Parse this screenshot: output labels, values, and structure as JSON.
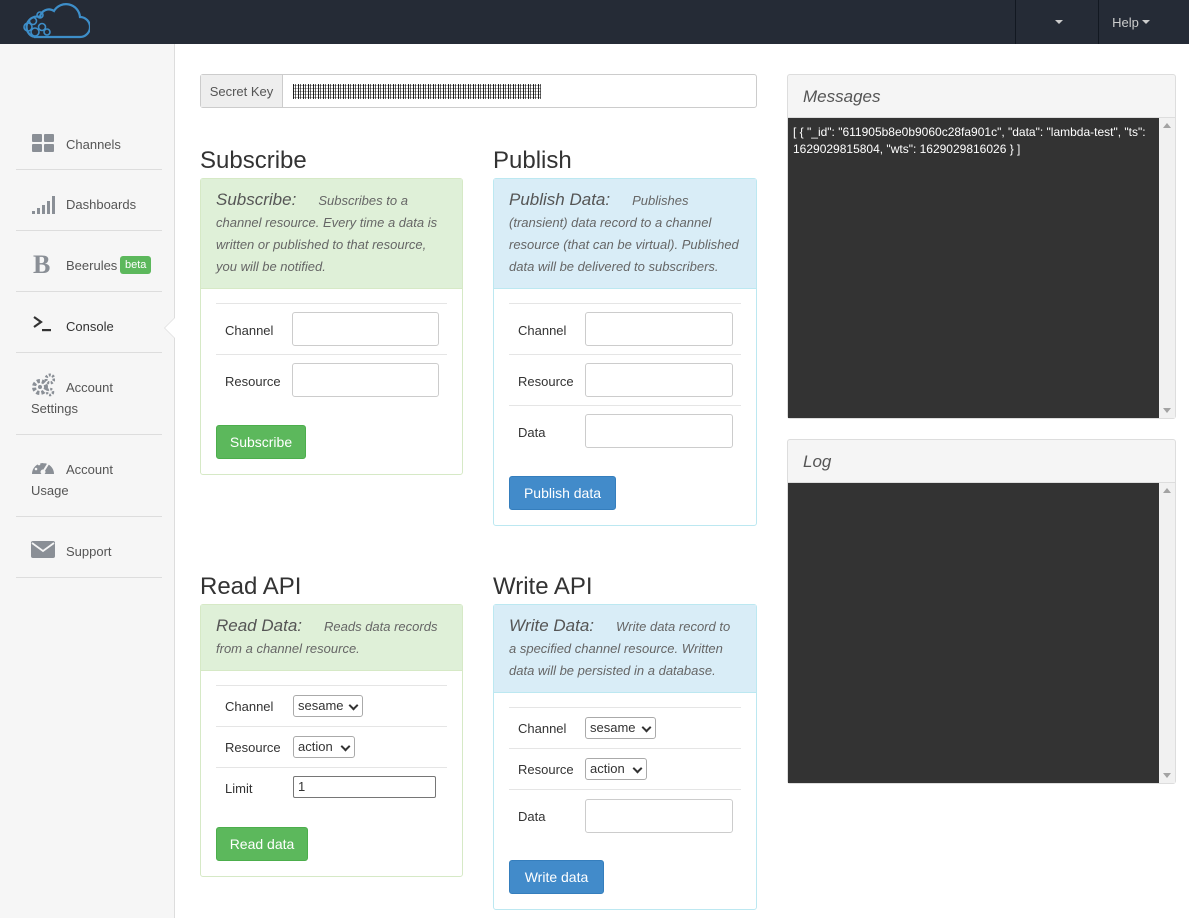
{
  "navbar": {
    "logo_icon": "cloud-logo-icon",
    "menu_dropdown_icon": "caret-down-icon",
    "help_label": "Help"
  },
  "sidebar": {
    "items": [
      {
        "label": "Channels",
        "icon": "grid-icon"
      },
      {
        "label": "Dashboards",
        "icon": "signal-bars-icon"
      },
      {
        "label": "Beerules",
        "icon": "bold-b-icon",
        "badge": "beta"
      },
      {
        "label": "Console",
        "icon": "terminal-icon",
        "active": true
      },
      {
        "label": "Account",
        "label2": "Settings",
        "icon": "gears-icon"
      },
      {
        "label": "Account",
        "label2": "Usage",
        "icon": "dashboard-gauge-icon"
      },
      {
        "label": "Support",
        "icon": "envelope-icon"
      }
    ]
  },
  "secret_key": {
    "label": "Secret Key"
  },
  "subscribe": {
    "section_title": "Subscribe",
    "head_title": "Subscribe:",
    "description": "Subscribes to a channel resource. Every time a data is written or published to that resource, you will be notified.",
    "channel_label": "Channel",
    "resource_label": "Resource",
    "button": "Subscribe"
  },
  "publish": {
    "section_title": "Publish",
    "head_title": "Publish Data:",
    "description": "Publishes (transient) data record to a channel resource (that can be virtual). Published data will be delivered to subscribers.",
    "channel_label": "Channel",
    "resource_label": "Resource",
    "data_label": "Data",
    "button": "Publish data"
  },
  "read_api": {
    "section_title": "Read API",
    "head_title": "Read Data:",
    "description": "Reads data records from a channel resource.",
    "channel_label": "Channel",
    "channel_value": "sesame",
    "resource_label": "Resource",
    "resource_value": "action",
    "limit_label": "Limit",
    "limit_value": "1",
    "button": "Read data"
  },
  "write_api": {
    "section_title": "Write API",
    "head_title": "Write Data:",
    "description": "Write data record to a specified channel resource. Written data will be persisted in a database.",
    "channel_label": "Channel",
    "channel_value": "sesame",
    "resource_label": "Resource",
    "resource_value": "action",
    "data_label": "Data",
    "button": "Write data"
  },
  "messages": {
    "title": "Messages",
    "content": "[ { \"_id\": \"611905b8e0b9060c28fa901c\", \"data\": \"lambda-test\", \"ts\": 1629029815804, \"wts\": 1629029816026 } ]"
  },
  "log": {
    "title": "Log",
    "content": ""
  },
  "colors": {
    "navbar": "#252b36",
    "success": "#5cb85c",
    "primary": "#428bca",
    "console_bg": "#333333"
  }
}
